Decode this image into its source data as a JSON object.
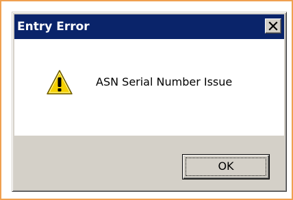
{
  "dialog": {
    "title": "Entry Error",
    "message": "ASN Serial Number Issue",
    "icon": "warning-icon",
    "ok_label": "OK",
    "close_icon": "close-icon"
  },
  "colors": {
    "titlebar": "#0a246a",
    "dialog_face": "#d4d0c8",
    "frame_outline": "#f0a050",
    "warning_yellow": "#f5d000"
  }
}
